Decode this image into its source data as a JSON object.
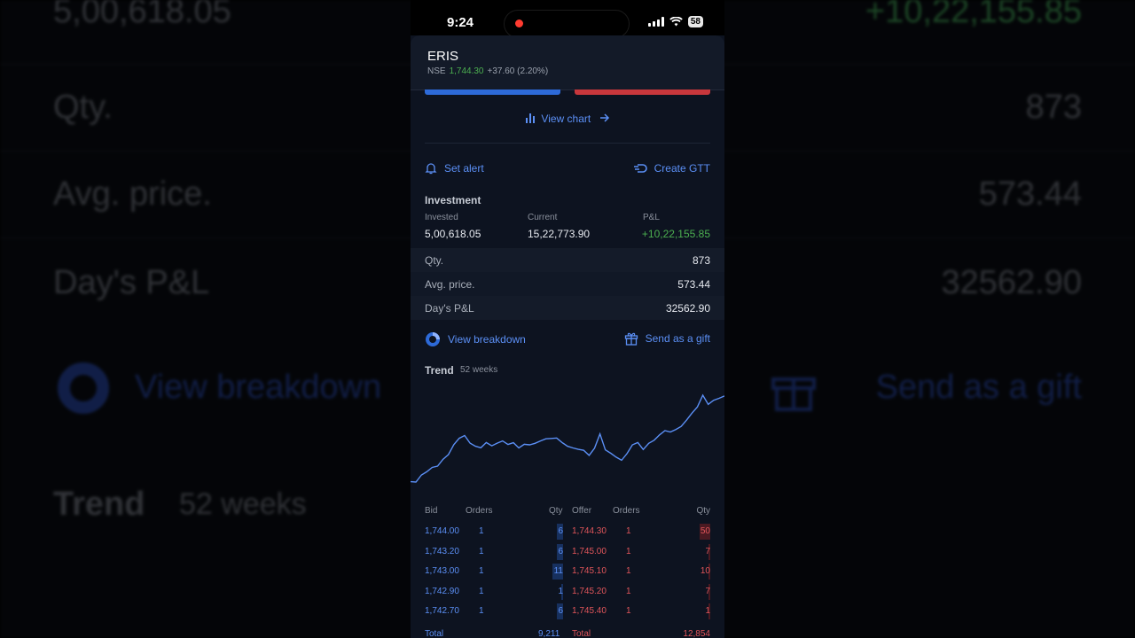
{
  "background": {
    "invested_value": "5,00,618.05",
    "pnl_value": "+10,22,155.85",
    "qty_label": "Qty.",
    "qty_value": "873",
    "avg_label": "Avg. price.",
    "avg_value": "573.44",
    "days_label": "Day's P&L",
    "days_value": "32562.90",
    "breakdown_label": "View breakdown",
    "gift_label": "Send as a gift",
    "trend_label": "Trend",
    "trend_sub": "52 weeks"
  },
  "status_bar": {
    "time": "9:24",
    "battery": "58"
  },
  "header": {
    "symbol": "ERIS",
    "exchange": "NSE",
    "ltp": "1,744.30",
    "change": "+37.60 (2.20%)"
  },
  "colors": {
    "accent": "#5b8ff5",
    "positive": "#4caf50",
    "negative": "#e0555a",
    "buy": "#2d6ad8",
    "sell": "#c8373c"
  },
  "actions": {
    "view_chart": "View chart",
    "set_alert": "Set alert",
    "create_gtt": "Create GTT",
    "view_breakdown": "View breakdown",
    "send_gift": "Send as a gift"
  },
  "investment": {
    "title": "Investment",
    "invested_label": "Invested",
    "invested_value": "5,00,618.05",
    "current_label": "Current",
    "current_value": "15,22,773.90",
    "pnl_label": "P&L",
    "pnl_value": "+10,22,155.85"
  },
  "details": [
    {
      "label": "Qty.",
      "value": "873"
    },
    {
      "label": "Avg. price.",
      "value": "573.44"
    },
    {
      "label": "Day's P&L",
      "value": "32562.90"
    }
  ],
  "trend": {
    "title": "Trend",
    "period": "52 weeks",
    "series": [
      1236,
      1234,
      1270,
      1287,
      1309,
      1316,
      1351,
      1375,
      1426,
      1459,
      1473,
      1434,
      1418,
      1410,
      1437,
      1420,
      1434,
      1445,
      1427,
      1436,
      1409,
      1428,
      1425,
      1433,
      1445,
      1456,
      1458,
      1460,
      1437,
      1418,
      1409,
      1402,
      1397,
      1371,
      1408,
      1481,
      1399,
      1382,
      1362,
      1346,
      1380,
      1425,
      1437,
      1401,
      1433,
      1449,
      1476,
      1498,
      1491,
      1504,
      1520,
      1552,
      1588,
      1620,
      1680,
      1633,
      1654,
      1664,
      1676
    ]
  },
  "depth": {
    "bid_header": "Bid",
    "orders_header": "Orders",
    "qty_header": "Qty",
    "offer_header": "Offer",
    "bids": [
      {
        "price": "1,744.00",
        "orders": "1",
        "qty": "6",
        "fill": 0.55
      },
      {
        "price": "1,743.20",
        "orders": "1",
        "qty": "6",
        "fill": 0.55
      },
      {
        "price": "1,743.00",
        "orders": "1",
        "qty": "11",
        "fill": 1.0
      },
      {
        "price": "1,742.90",
        "orders": "1",
        "qty": "1",
        "fill": 0.1
      },
      {
        "price": "1,742.70",
        "orders": "1",
        "qty": "6",
        "fill": 0.55
      }
    ],
    "offers": [
      {
        "price": "1,744.30",
        "orders": "1",
        "qty": "50",
        "fill": 1.0
      },
      {
        "price": "1,745.00",
        "orders": "1",
        "qty": "7",
        "fill": 0.14
      },
      {
        "price": "1,745.10",
        "orders": "1",
        "qty": "10",
        "fill": 0.2
      },
      {
        "price": "1,745.20",
        "orders": "1",
        "qty": "7",
        "fill": 0.14
      },
      {
        "price": "1,745.40",
        "orders": "1",
        "qty": "1",
        "fill": 0.02
      }
    ],
    "total_label": "Total",
    "bid_total": "9,211",
    "offer_total": "12,854"
  }
}
